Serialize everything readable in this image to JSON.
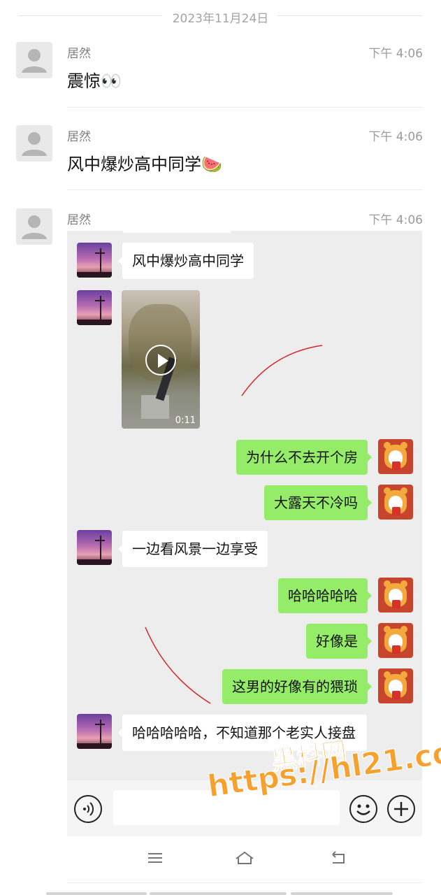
{
  "date_divider": "2023年11月24日",
  "messages": [
    {
      "sender": "居然",
      "time": "下午 4:06",
      "text": "震惊👀"
    },
    {
      "sender": "居然",
      "time": "下午 4:06",
      "text": "风中爆炒高中同学🍉"
    },
    {
      "sender": "居然",
      "time": "下午 4:06"
    }
  ],
  "screenshot_chat": {
    "bubbles": [
      {
        "side": "left",
        "text": "风中爆炒高中同学"
      },
      {
        "side": "left",
        "type": "video",
        "duration": "0:11"
      },
      {
        "side": "right",
        "text": "为什么不去开个房"
      },
      {
        "side": "right",
        "text": "大露天不冷吗"
      },
      {
        "side": "left",
        "text": "一边看风景一边享受"
      },
      {
        "side": "right",
        "text": "哈哈哈哈哈"
      },
      {
        "side": "right",
        "text": "好像是"
      },
      {
        "side": "right",
        "text": "这男的好像有的猥琐"
      },
      {
        "side": "left",
        "text": "哈哈哈哈哈，不知道那个老实人接盘"
      }
    ],
    "input_icons": [
      "voice-icon",
      "emoji-icon",
      "plus-icon"
    ]
  },
  "watermark": {
    "line1": "黑料网",
    "line2": "https://hl21.co",
    "color": "#f6a12e"
  },
  "system_nav": [
    "menu-icon",
    "home-icon",
    "back-icon"
  ],
  "colors": {
    "sent_bubble": "#95ec69",
    "chat_bg": "#ededed"
  }
}
